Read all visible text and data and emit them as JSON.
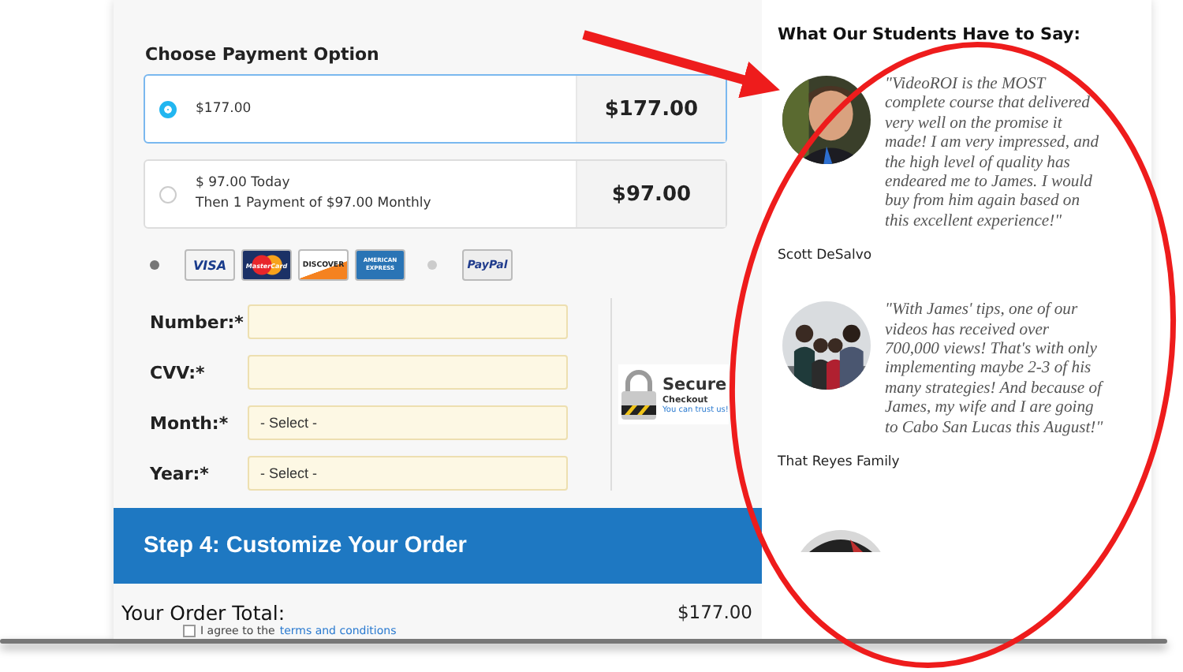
{
  "payment": {
    "title": "Choose Payment Option",
    "options": [
      {
        "lines": [
          "$177.00"
        ],
        "price": "$177.00",
        "selected": true
      },
      {
        "lines": [
          "$ 97.00 Today",
          "Then 1 Payment of $97.00 Monthly"
        ],
        "price": "$97.00",
        "selected": false
      }
    ],
    "methods": [
      {
        "selected": true,
        "cards": [
          {
            "kind": "visa",
            "label": "VISA"
          },
          {
            "kind": "mastercard",
            "label": "MasterCard"
          },
          {
            "kind": "discover",
            "label": "DISCOVER"
          },
          {
            "kind": "amex",
            "label": "AMERICAN EXPRESS"
          }
        ]
      },
      {
        "selected": false,
        "cards": [
          {
            "kind": "paypal",
            "label": "PayPal"
          }
        ]
      }
    ],
    "fields": [
      {
        "label": "Number:*",
        "kind": "text"
      },
      {
        "label": "CVV:*",
        "kind": "text"
      },
      {
        "label": "Month:*",
        "kind": "select",
        "value": "- Select -"
      },
      {
        "label": "Year:*",
        "kind": "select",
        "value": "- Select -"
      }
    ],
    "secure_badge": {
      "title": "Secure",
      "subtitle": "Checkout",
      "tagline": "You can trust us!"
    }
  },
  "step": {
    "title": "Step 4: Customize Your Order"
  },
  "order_total": {
    "label": "Your Order Total:",
    "value": "$177.00"
  },
  "terms": {
    "checked": false,
    "text": "I agree to the",
    "link": "terms and conditions"
  },
  "testimonials": {
    "heading": "What Our Students Have to Say:",
    "items": [
      {
        "quote": "\"VideoROI is the MOST complete course that delivered very well on the promise it made! I am very impressed, and the high level of quality has endeared me to James. I would buy from him again based on this excellent experience!\"",
        "author": "Scott DeSalvo"
      },
      {
        "quote": "\"With James' tips, one of our videos has received over 700,000 views! That's with only implementing maybe 2-3 of his many strategies! And because of James, my wife and I are going to Cabo San Lucas this August!\"",
        "author": "That Reyes Family"
      }
    ]
  }
}
